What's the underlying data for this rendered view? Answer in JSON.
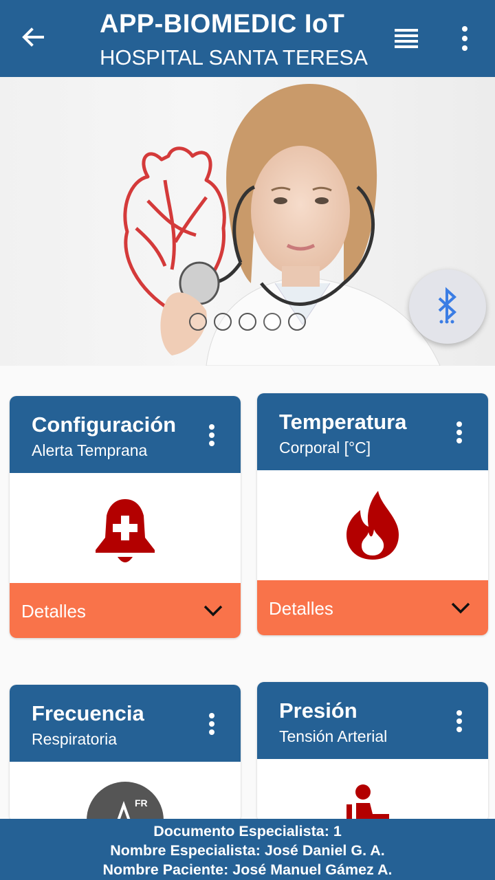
{
  "appbar": {
    "title": "APP-BIOMEDIC IoT",
    "subtitle": "HOSPITAL SANTA TERESA",
    "back_icon": "arrow-back-icon",
    "list_icon": "list-icon",
    "menu_icon": "more-vert-icon"
  },
  "carousel": {
    "slide_count": 5,
    "active_index": 3,
    "image_description_icon": "doctor-heart-image"
  },
  "fab": {
    "icon": "bluetooth-searching-icon",
    "color": "#3b7de4"
  },
  "cards": [
    {
      "title": "Configuración",
      "subtitle": "Alerta Temprana",
      "icon": "alarm-add-icon",
      "details_label": "Detalles"
    },
    {
      "title": "Temperatura",
      "subtitle": "Corporal [°C]",
      "icon": "flame-icon",
      "details_label": "Detalles"
    },
    {
      "title": "Frecuencia",
      "subtitle": "Respiratoria",
      "icon": "respiratory-rate-icon",
      "icon_text": "FR"
    },
    {
      "title": "Presión",
      "subtitle": "Tensión Arterial",
      "icon": "blood-pressure-icon"
    }
  ],
  "footer": {
    "line1": "Documento Especialista: 1",
    "line2": "Nombre Especialista: José Daniel G. A.",
    "line3": "Nombre Paciente: José Manuel Gámez A."
  },
  "colors": {
    "primary": "#256195",
    "accent": "#f9734a",
    "icon_red": "#b30000"
  }
}
